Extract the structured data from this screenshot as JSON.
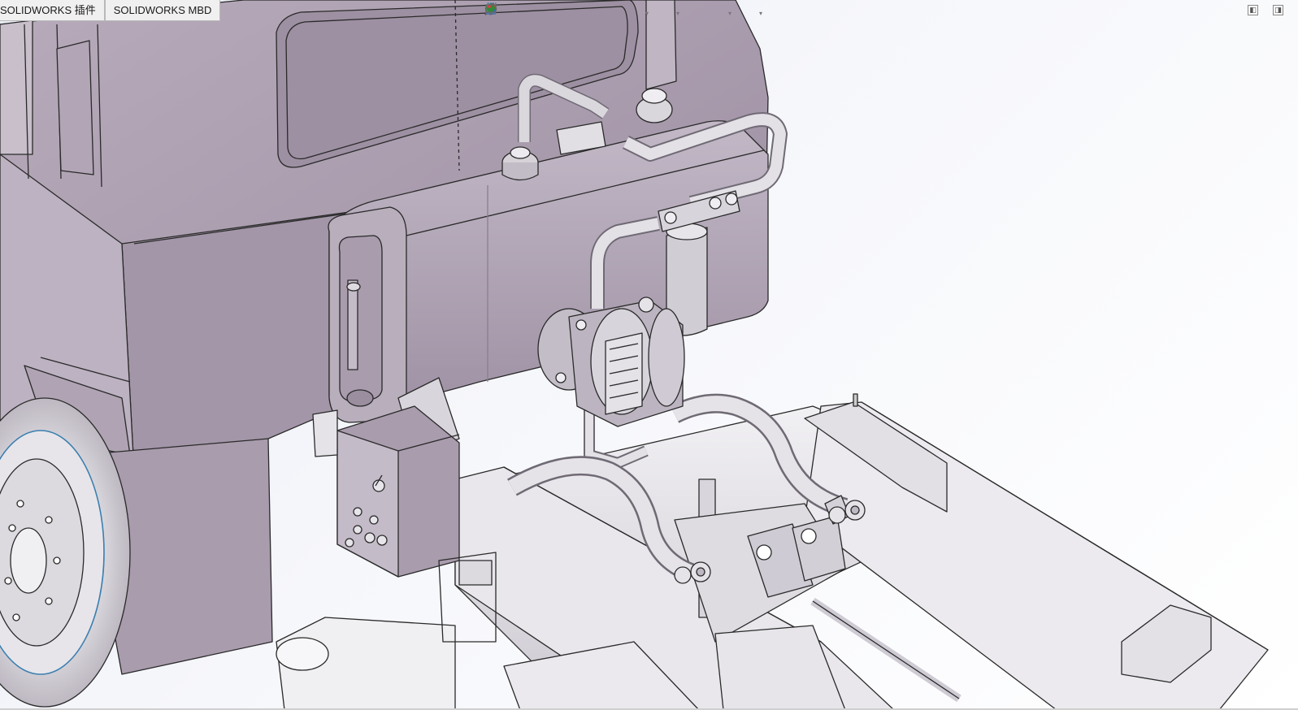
{
  "tabs": [
    {
      "label": "SOLIDWORKS 插件"
    },
    {
      "label": "SOLIDWORKS MBD"
    }
  ],
  "heads_up_toolbar": {
    "icons": [
      "zoom-to-fit-icon",
      "zoom-to-area-icon",
      "previous-view-icon",
      "section-view-icon",
      "dynamic-annotation-views-icon",
      "view-orientation-icon",
      "display-style-icon",
      "hide-show-items-icon",
      "edit-appearance-icon",
      "apply-scene-icon",
      "view-settings-icon"
    ]
  },
  "window_controls": [
    "restore-down-icon",
    "maximize-icon"
  ],
  "model": {
    "name": "truck-chassis-hydraulic-assembly",
    "colors": {
      "cab": "#a497a9",
      "cab_light": "#c5bcc9",
      "tank": "#a89cae",
      "chassis": "#e6e4e8",
      "background_top": "#e9ecf3",
      "background_bottom": "#ffffff",
      "edge": "#2a2a2a"
    }
  }
}
